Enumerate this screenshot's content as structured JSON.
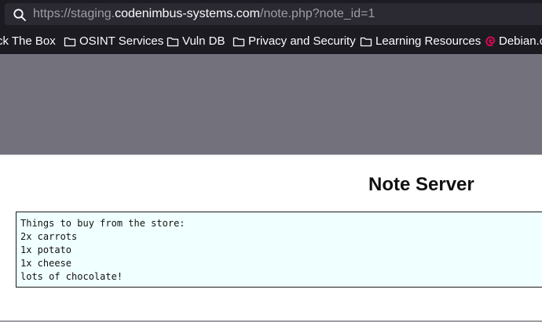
{
  "browser": {
    "url": {
      "prefix": "https://staging.",
      "host": "codenimbus-systems.com",
      "path": "/note.php?note_id=1"
    }
  },
  "bookmarks": [
    {
      "label": "ck The Box",
      "icon": "folder-icon"
    },
    {
      "label": "OSINT Services",
      "icon": "folder-icon"
    },
    {
      "label": "Vuln DB",
      "icon": "folder-icon"
    },
    {
      "label": "Privacy and Security",
      "icon": "folder-icon"
    },
    {
      "label": "Learning Resources",
      "icon": "folder-icon"
    },
    {
      "label": "Debian.c",
      "icon": "debian-swirl-icon"
    }
  ],
  "page": {
    "title": "Note Server",
    "note_lines": [
      "Things to buy from the store:",
      "2x carrots",
      "1x potato",
      "1x cheese",
      "lots of chocolate!"
    ]
  },
  "colors": {
    "toolbar": "#1c1b22",
    "url_field": "#2b2a33",
    "header_band": "#73727c",
    "note_background": "#f0ffff",
    "debian_red": "#d70a53"
  }
}
